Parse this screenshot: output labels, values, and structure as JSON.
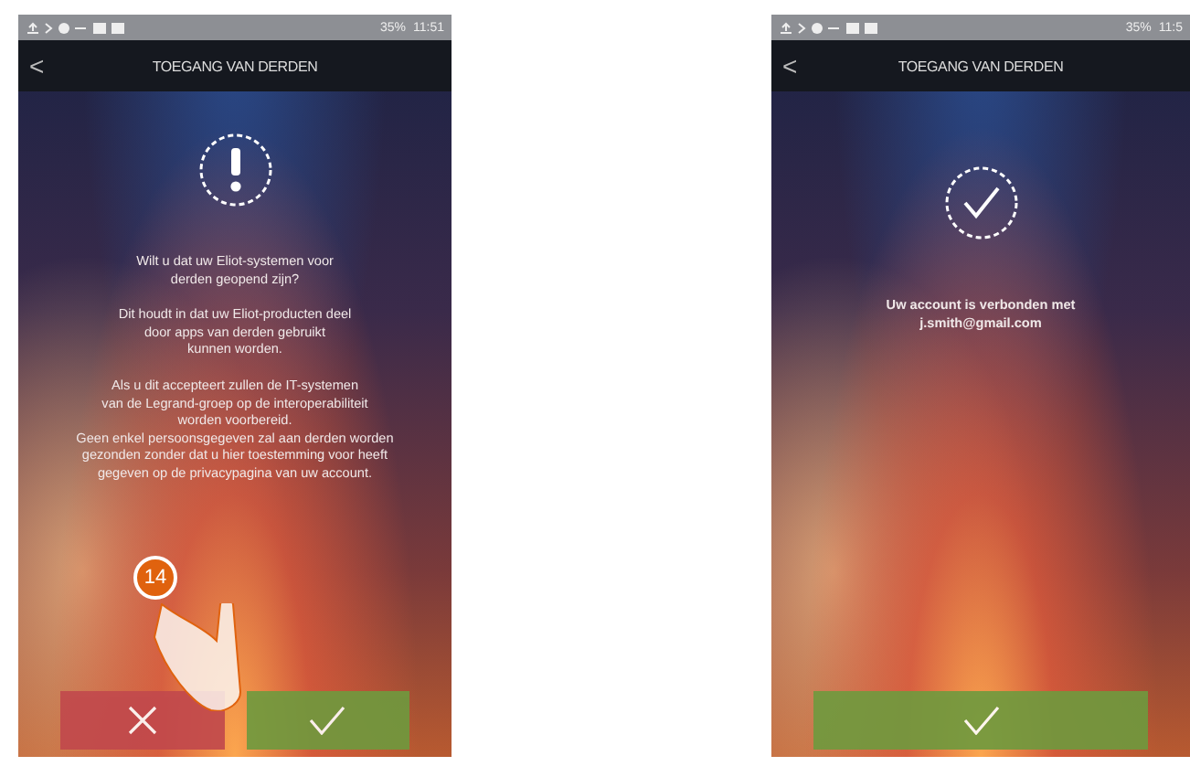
{
  "phones": [
    {
      "status": {
        "battery": "35%",
        "time": "11:51"
      },
      "header": {
        "back": "<",
        "title": "TOEGANG VAN DERDEN"
      },
      "kind": "question",
      "paragraphs": [
        "Wilt u dat uw Eliot-systemen voor\nderden geopend zijn?",
        "Dit houdt in dat uw Eliot-producten deel\ndoor apps van derden gebruikt\nkunnen worden.",
        "Als u dit accepteert zullen de IT-systemen\nvan de Legrand-groep op de interoperabiliteit\nworden voorbereid.\nGeen enkel persoonsgegeven zal aan derden worden\ngezonden zonder dat u hier toestemming voor heeft\ngegeven op de privacypagina van uw account."
      ],
      "step": "14",
      "buttons": [
        {
          "kind": "cancel"
        },
        {
          "kind": "confirm"
        }
      ]
    },
    {
      "status": {
        "battery": "35%",
        "time": "11:5"
      },
      "header": {
        "back": "<",
        "title": "TOEGANG VAN DERDEN"
      },
      "kind": "confirmation",
      "paragraphs": [
        "Uw account is verbonden met\nj.smith@gmail.com"
      ],
      "buttons": [
        {
          "kind": "confirm"
        }
      ]
    }
  ]
}
